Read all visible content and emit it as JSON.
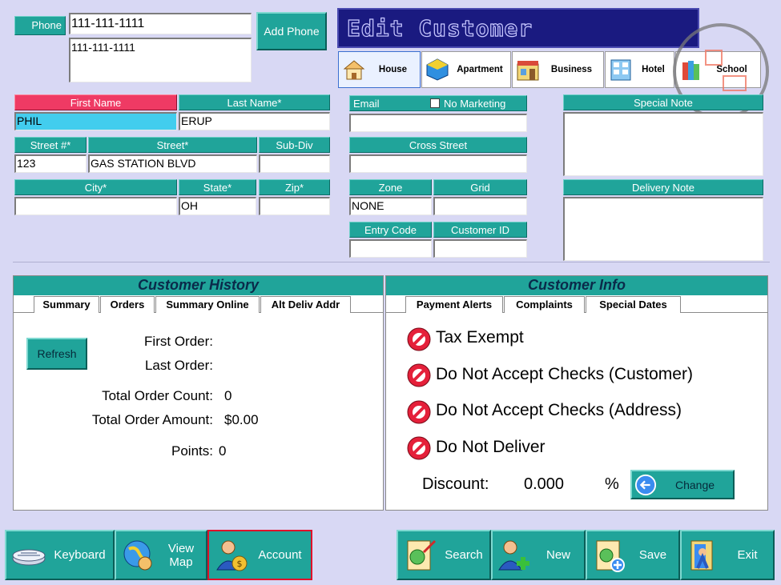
{
  "phone": {
    "label": "Phone",
    "primary_value": "111-111-1111",
    "list_value": "111-111-1111",
    "add_button": "Add Phone"
  },
  "banner": {
    "title": "Edit Customer"
  },
  "address_types": [
    {
      "label": "House",
      "icon": "house-icon"
    },
    {
      "label": "Apartment",
      "icon": "apartment-icon"
    },
    {
      "label": "Business",
      "icon": "business-icon"
    },
    {
      "label": "Hotel",
      "icon": "hotel-icon"
    },
    {
      "label": "School",
      "icon": "school-icon"
    }
  ],
  "form": {
    "first_name_label": "First Name",
    "first_name_value": "PHIL",
    "last_name_label": "Last Name*",
    "last_name_value": "ERUP",
    "street_no_label": "Street #*",
    "street_no_value": "123",
    "street_label": "Street*",
    "street_value": "GAS STATION BLVD",
    "subdiv_label": "Sub-Div",
    "subdiv_value": "",
    "city_label": "City*",
    "city_value": "",
    "state_label": "State*",
    "state_value": "OH",
    "zip_label": "Zip*",
    "zip_value": "",
    "email_label": "Email",
    "no_marketing_label": "No Marketing",
    "email_value": "",
    "cross_street_label": "Cross Street",
    "cross_street_value": "",
    "zone_label": "Zone",
    "zone_value": "NONE",
    "grid_label": "Grid",
    "grid_value": "",
    "entry_code_label": "Entry Code",
    "entry_code_value": "",
    "customer_id_label": "Customer ID",
    "customer_id_value": "",
    "special_note_label": "Special Note",
    "delivery_note_label": "Delivery Note"
  },
  "history": {
    "title": "Customer History",
    "tabs": [
      "Summary",
      "Orders",
      "Summary Online",
      "Alt Deliv Addr"
    ],
    "refresh": "Refresh",
    "first_order_label": "First Order:",
    "last_order_label": "Last Order:",
    "total_count_label": "Total Order Count:",
    "total_count_value": "0",
    "total_amount_label": "Total Order Amount:",
    "total_amount_value": "$0.00",
    "points_label": "Points:",
    "points_value": "0"
  },
  "info": {
    "title": "Customer Info",
    "tabs": [
      "Payment Alerts",
      "Complaints",
      "Special Dates"
    ],
    "alerts": [
      "Tax Exempt",
      "Do Not Accept Checks (Customer)",
      "Do Not Accept Checks (Address)",
      "Do Not Deliver"
    ],
    "discount_label": "Discount:",
    "discount_value": "0.000",
    "discount_unit": "%",
    "change_button": "Change"
  },
  "toolbar": {
    "left": [
      {
        "label": "Keyboard",
        "icon": "keyboard-icon"
      },
      {
        "label": "View Map",
        "icon": "globe-icon"
      },
      {
        "label": "Account",
        "icon": "account-icon"
      }
    ],
    "right": [
      {
        "label": "Search",
        "icon": "search-icon"
      },
      {
        "label": "New",
        "icon": "new-customer-icon"
      },
      {
        "label": "Save",
        "icon": "save-icon"
      },
      {
        "label": "Exit",
        "icon": "exit-icon"
      }
    ]
  },
  "colors": {
    "background": "#d8d8f4",
    "teal": "#20a49a",
    "first_name_label": "#ef3a64",
    "first_name_field": "#42cdee",
    "banner": "#1a1a80",
    "highlight_border": "#e0102a"
  }
}
